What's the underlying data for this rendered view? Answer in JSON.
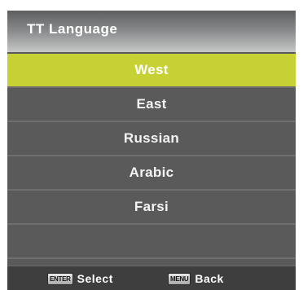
{
  "menu": {
    "title": "TT Language",
    "items": [
      {
        "label": "West",
        "selected": true
      },
      {
        "label": "East",
        "selected": false
      },
      {
        "label": "Russian",
        "selected": false
      },
      {
        "label": "Arabic",
        "selected": false
      },
      {
        "label": "Farsi",
        "selected": false
      }
    ],
    "highlight_color": "#c7d134"
  },
  "footer": {
    "select_key": "ENTER",
    "select_label": "Select",
    "back_key": "MENU",
    "back_label": "Back"
  }
}
